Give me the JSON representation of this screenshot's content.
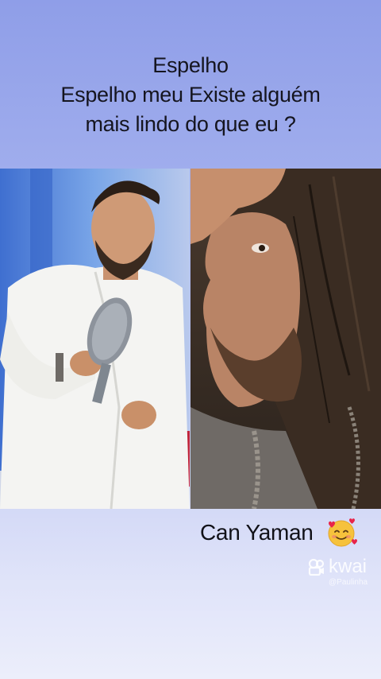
{
  "caption": {
    "line1": "Espelho",
    "line2": "Espelho meu  Existe alguém",
    "line3": "mais lindo do que eu ?"
  },
  "photos": {
    "left": "man-with-hand-mirror-photo",
    "right": "man-long-hair-profile-photo"
  },
  "name_label": {
    "text": "Can Yaman",
    "emoji_icon": "smiling-face-with-hearts-icon"
  },
  "watermark": {
    "brand": "kwai",
    "handle": "@Paulinha",
    "logo_icon": "kwai-logo-icon"
  },
  "colors": {
    "background_top": "#8f9ee8",
    "background_bottom": "#eceefb",
    "text": "#15151f"
  }
}
